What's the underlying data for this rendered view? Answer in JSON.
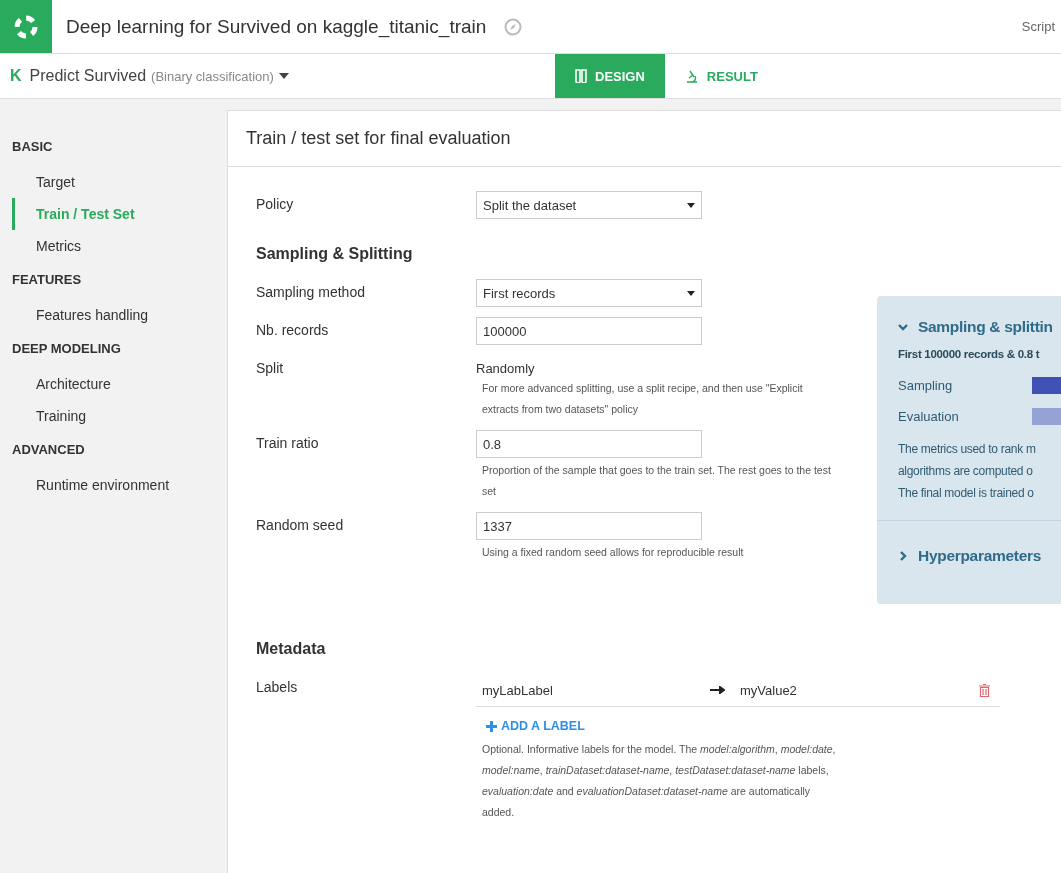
{
  "header": {
    "title": "Deep learning for Survived on kaggle_titanic_train",
    "script_link": "Script"
  },
  "subheader": {
    "badge": "K",
    "task": "Predict Survived",
    "task_type": "(Binary classification)",
    "tabs": [
      {
        "label": "DESIGN",
        "selected": true
      },
      {
        "label": "RESULT",
        "selected": false
      }
    ]
  },
  "sidebar": {
    "sections": [
      {
        "title": "BASIC",
        "items": [
          {
            "label": "Target",
            "selected": false
          },
          {
            "label": "Train / Test Set",
            "selected": true
          },
          {
            "label": "Metrics",
            "selected": false
          }
        ]
      },
      {
        "title": "FEATURES",
        "items": [
          {
            "label": "Features handling",
            "selected": false
          }
        ]
      },
      {
        "title": "DEEP MODELING",
        "items": [
          {
            "label": "Architecture",
            "selected": false
          },
          {
            "label": "Training",
            "selected": false
          }
        ]
      },
      {
        "title": "ADVANCED",
        "items": [
          {
            "label": "Runtime environment",
            "selected": false
          }
        ]
      }
    ]
  },
  "card": {
    "title": "Train / test set for final evaluation",
    "policy": {
      "label": "Policy",
      "value": "Split the dataset"
    },
    "sampling": {
      "heading": "Sampling & Splitting",
      "rows": [
        {
          "kind": "select",
          "label": "Sampling method",
          "value": "First records"
        },
        {
          "kind": "input",
          "label": "Nb. records",
          "value": "100000"
        },
        {
          "kind": "text",
          "label": "Split",
          "value": "Randomly",
          "help": "For more advanced splitting, use a split recipe, and then use \"Explicit extracts from two datasets\" policy"
        },
        {
          "kind": "input",
          "label": "Train ratio",
          "value": "0.8",
          "help": "Proportion of the sample that goes to the train set. The rest goes to the test set"
        },
        {
          "kind": "input",
          "label": "Random seed",
          "value": "1337",
          "help": "Using a fixed random seed allows for reproducible result"
        }
      ]
    },
    "panel": {
      "sections": [
        {
          "title": "Sampling & splittin",
          "expanded": true,
          "summary": "First 100000 records & 0.8 t",
          "bars": [
            {
              "label": "Sampling",
              "color": "#3f51b5"
            },
            {
              "label": "Evaluation",
              "color": "#95a3d4"
            }
          ],
          "lines": [
            "The metrics used to rank m",
            "algorithms are computed o",
            "The final model is trained o"
          ]
        },
        {
          "title": "Hyperparameters",
          "expanded": false
        }
      ]
    },
    "metadata": {
      "heading": "Metadata",
      "label": "Labels",
      "entries": [
        {
          "key": "myLabLabel",
          "value": "myValue2"
        }
      ],
      "add_button": "ADD A LABEL",
      "help": "Optional. Informative labels for the model. The *model:algorithm*, *model:date*, *model:name*, *trainDataset:dataset-name*, *testDataset:dataset-name* labels, *evaluation:date* and *evaluationDataset:dataset-name* are automatically added."
    }
  }
}
